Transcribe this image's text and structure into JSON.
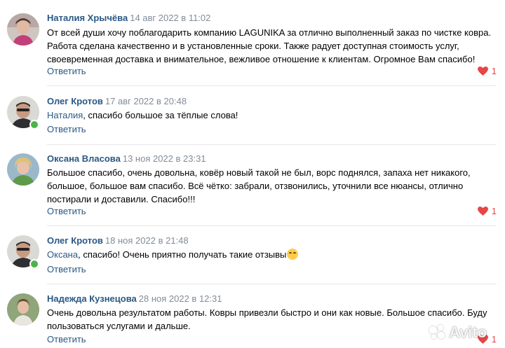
{
  "colors": {
    "author": "#2a5885",
    "date": "#818c99",
    "like": "#e64646",
    "online": "#4bb34b"
  },
  "comments": [
    {
      "author": "Наталия Хрычёва",
      "date": "14 авг 2022 в 11:02",
      "text": "От всей души хочу поблагодарить компанию LAGUNIKA за отлично выполненный заказ по чистке ковра. Работа сделана качественно и в установленные сроки. Также радует доступная стоимость услуг, своевременная доставка и внимательное, вежливое отношение к клиентам. Огромное Вам спасибо!",
      "reply": "Ответить",
      "likes": "1"
    },
    {
      "author": "Олег Кротов",
      "date": "17 авг 2022 в 20:48",
      "mention": "Наталия",
      "text": ", спасибо большое за тёплые слова!",
      "reply": "Ответить"
    },
    {
      "author": "Оксана Власова",
      "date": "13 ноя 2022 в 23:31",
      "text": "Большое спасибо, очень довольна, ковёр новый такой не был, ворс поднялся, запаха нет никакого, большое, большое вам спасибо. Всё чётко: забрали, отзвонились, уточнили все нюансы, отлично постирали и доставили. Спасибо!!!",
      "reply": "Ответить",
      "likes": "1"
    },
    {
      "author": "Олег Кротов",
      "date": "18 ноя 2022 в 21:48",
      "mention": "Оксана",
      "text": ", спасибо! Очень приятно получать такие отзывы",
      "emoji": "smiling-face-icon",
      "reply": "Ответить"
    },
    {
      "author": "Надежда Кузнецова",
      "date": "28 ноя 2022 в 12:31",
      "text": "Очень довольна результатом работы. Ковры привезли быстро и они как новые. Большое спасибо. Буду пользоваться услугами и дальше.",
      "reply": "Ответить",
      "likes": "1"
    }
  ],
  "watermark": "Avito"
}
